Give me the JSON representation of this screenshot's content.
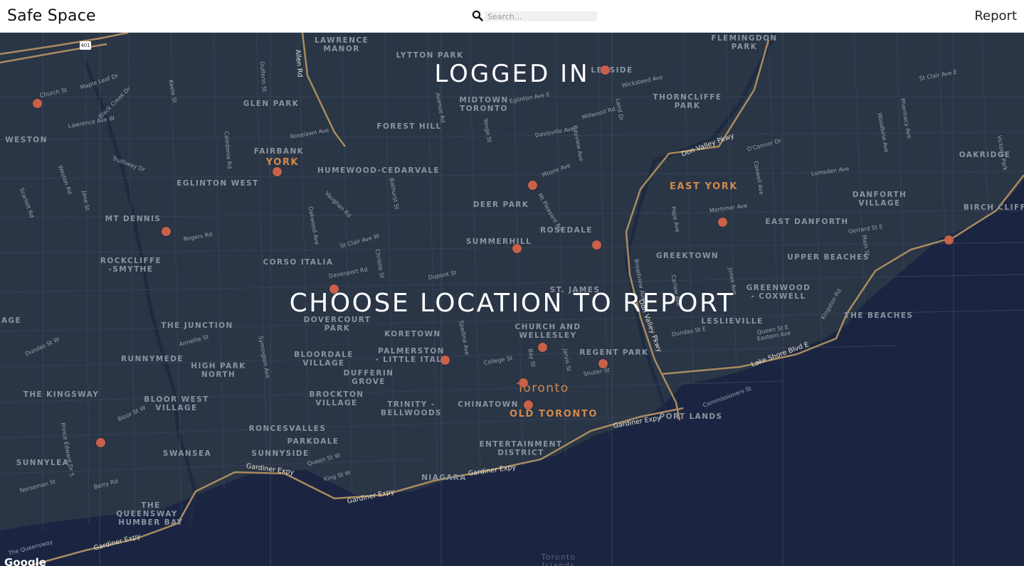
{
  "header": {
    "brand": "Safe Space",
    "search_placeholder": "Search...",
    "report_label": "Report"
  },
  "overlay": {
    "status": "LOGGED IN",
    "instruction": "CHOOSE LOCATION TO REPORT"
  },
  "map": {
    "attribution": "Google",
    "highway_shield": "401",
    "colors": {
      "land": "#2a3546",
      "water": "#1b2541",
      "highway": "#a98b5f",
      "marker": "#c9604a",
      "neighbourhood_label": "#8c93a0",
      "accent_label": "#d08a4c"
    },
    "neighbourhoods": [
      "LAWRENCE\nMANOR",
      "LYTTON PARK",
      "FLEMINGDON\nPARK",
      "GLEN PARK",
      "MIDTOWN\nTORONTO",
      "THORNCLIFFE\nPARK",
      "WESTON",
      "FOREST HILL",
      "FAIRBANK",
      "HUMEWOOD-CEDARVALE",
      "OAKRIDGE",
      "EGLINTON WEST",
      "DEER PARK",
      "DANFORTH\nVILLAGE",
      "BIRCH CLIFF",
      "MT DENNIS",
      "ROSEDALE",
      "EAST DANFORTH",
      "SUMMERHILL",
      "ROCKCLIFFE\n-SMYTHE",
      "CORSO ITALIA",
      "GREEKTOWN",
      "UPPER BEACHES",
      "GREENWOOD\n- COXWELL",
      "AGE",
      "DOVERCOURT\nPARK",
      "THE JUNCTION",
      "CHURCH AND\nWELLESLEY",
      "THE BEACHES",
      "LESLIEVILLE",
      "KORETOWN",
      "RUNNYMEDE",
      "BLOORDALE\nVILLAGE",
      "PALMERSTON\n- LITTLE ITALY",
      "REGENT PARK",
      "HIGH PARK\nNORTH",
      "DUFFERIN\nGROVE",
      "THE KINGSWAY",
      "BLOOR WEST\nVILLAGE",
      "BROCKTON\nVILLAGE",
      "TRINITY -\nBELLWOODS",
      "CHINATOWN",
      "PORT LANDS",
      "RONCESVALLES",
      "PARKDALE",
      "ENTERTAINMENT\nDISTRICT",
      "SUNNYLEA",
      "SWANSEA",
      "SUNNYSIDE",
      "NIAGARA",
      "THE\nQUEENSWAY -\nHUMBER BAY",
      "ST. JAMES",
      "LEASIDE"
    ],
    "accent_places": [
      "YORK",
      "EAST YORK",
      "OLD TORONTO"
    ],
    "city": "Toronto",
    "islands": "Toronto\nIslands",
    "streets": [
      "Church St",
      "Maple Leaf Dr",
      "Black Creek Dr",
      "Lawrence Ave W",
      "Truthway Dr",
      "Weston Rd",
      "Jane St",
      "Scarlett Rd",
      "Keele St",
      "Dufferin St",
      "Caledonia Rd",
      "Roselawn Ave",
      "Avenue Rd",
      "Bathurst St",
      "Yonge St",
      "Eglinton Ave E",
      "Davisville Ave",
      "Bayview Ave",
      "Millwood Rd",
      "Wicksteed Ave",
      "Laird Dr",
      "O'Connor Dr",
      "Coxwell Ave",
      "Lumsden Ave",
      "Mortimer Ave",
      "Gerrard St E",
      "Victoria Park",
      "Pharmacy Ave",
      "St Clair Ave E",
      "Moore Ave",
      "Mt Pleasant Rd",
      "Rogers Rd",
      "St Clair Ave W",
      "Davenport Rd",
      "Dupont St",
      "College St",
      "Dundas St W",
      "Bloor St W",
      "Queen St W",
      "King St W",
      "Dundas St E",
      "Queen St E",
      "Eastern Ave",
      "Commissioners St",
      "Kingston Rd",
      "Annette St",
      "Symington Ave",
      "Christie St",
      "Bay St",
      "Jarvis St",
      "Shuter St",
      "Spadina Ave",
      "Oakwood Ave",
      "Vaughan Rd",
      "Prince Edward Dr S",
      "Berry Rd",
      "Norseman St",
      "The Queensway",
      "Pape Ave",
      "Jones Ave",
      "Main St",
      "Woodbine Ave",
      "Carlaw Ave",
      "Broadview Ave"
    ],
    "highways": [
      "Don Valley Pkwy",
      "Gardiner Expy",
      "Lake Shore Blvd E",
      "Kingston Rd",
      "Allen Rd",
      "401"
    ]
  }
}
